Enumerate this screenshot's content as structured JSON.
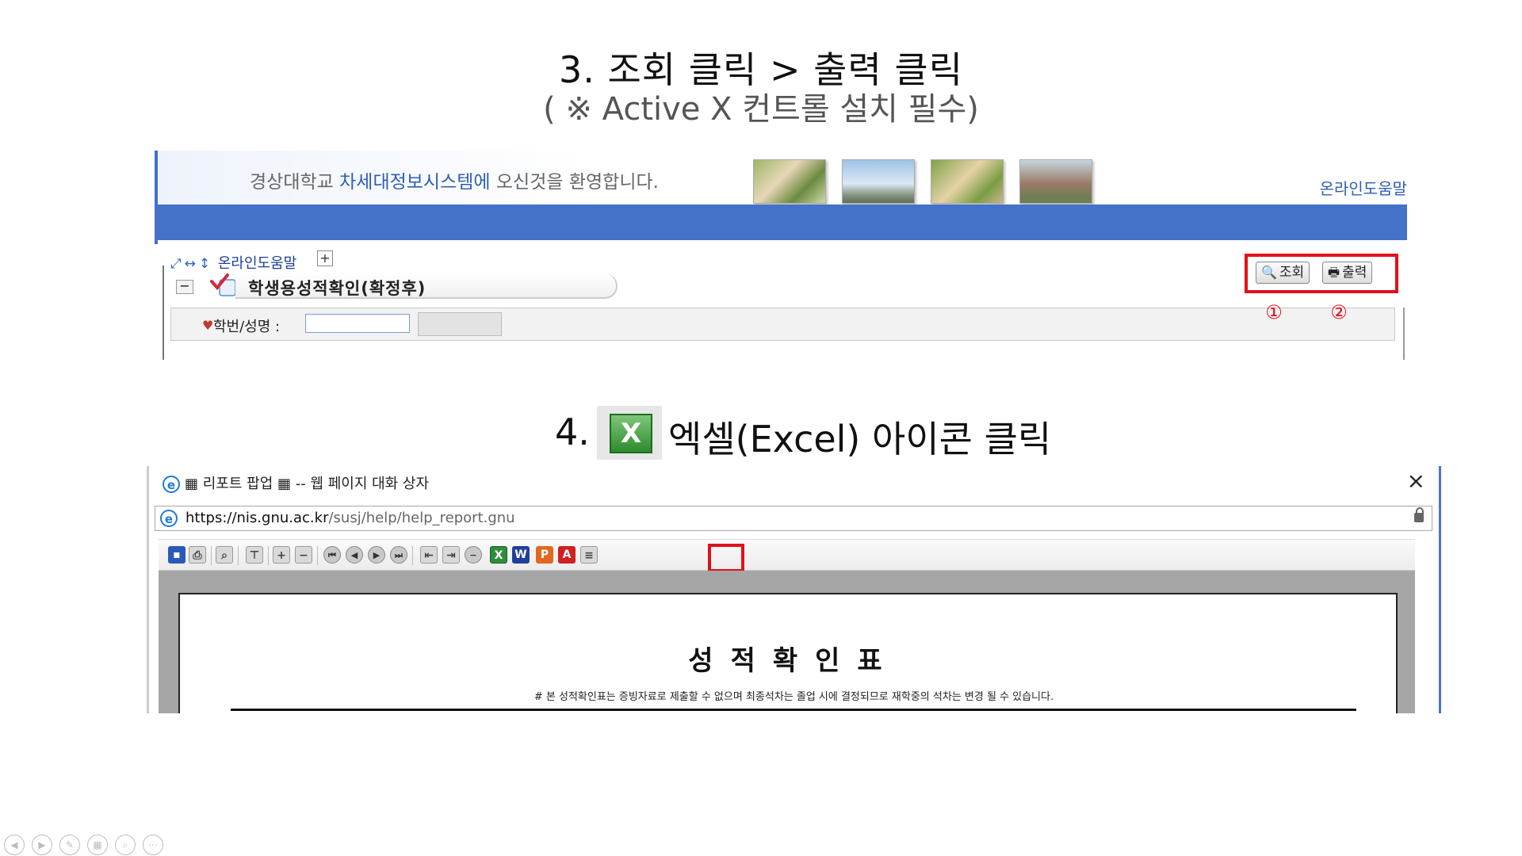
{
  "step3": {
    "title": "3.   조회 클릭 > 출력 클릭",
    "subtitle": "( ※ Active X 컨트롤 설치 필수)"
  },
  "step4": {
    "number": "4.",
    "icon": "excel-icon",
    "title": "엑셀(Excel) 아이콘 클릭"
  },
  "portal": {
    "welcome_pre": "경상대학교 ",
    "welcome_highlight": "차세대정보시스템에",
    "welcome_post": " 오신것을 환영합니다.",
    "help_link": "온라인도움말",
    "nav_help": "온라인도움말",
    "page_title": "학생용성적확인(확정후)",
    "field_label": "학번/성명 :",
    "field_value": "",
    "search_button": "조회",
    "print_button": "출력",
    "marker_1": "①",
    "marker_2": "②",
    "accent_color": "#4472c8",
    "highlight_color": "#e0101a"
  },
  "popup": {
    "window_title": "▦ 리포트 팝업 ▦ -- 웹 페이지 대화 상자",
    "url_host": "https://nis.gnu.ac.kr",
    "url_path": "/susj/help/help_report.gnu",
    "report_title": "성적확인표",
    "report_note": "# 본 성적확인표는 증빙자료로 제출할 수 없으며 최종석차는 졸업 시에 결정되므로 재학중의 석차는 변경 될 수 있습니다."
  }
}
